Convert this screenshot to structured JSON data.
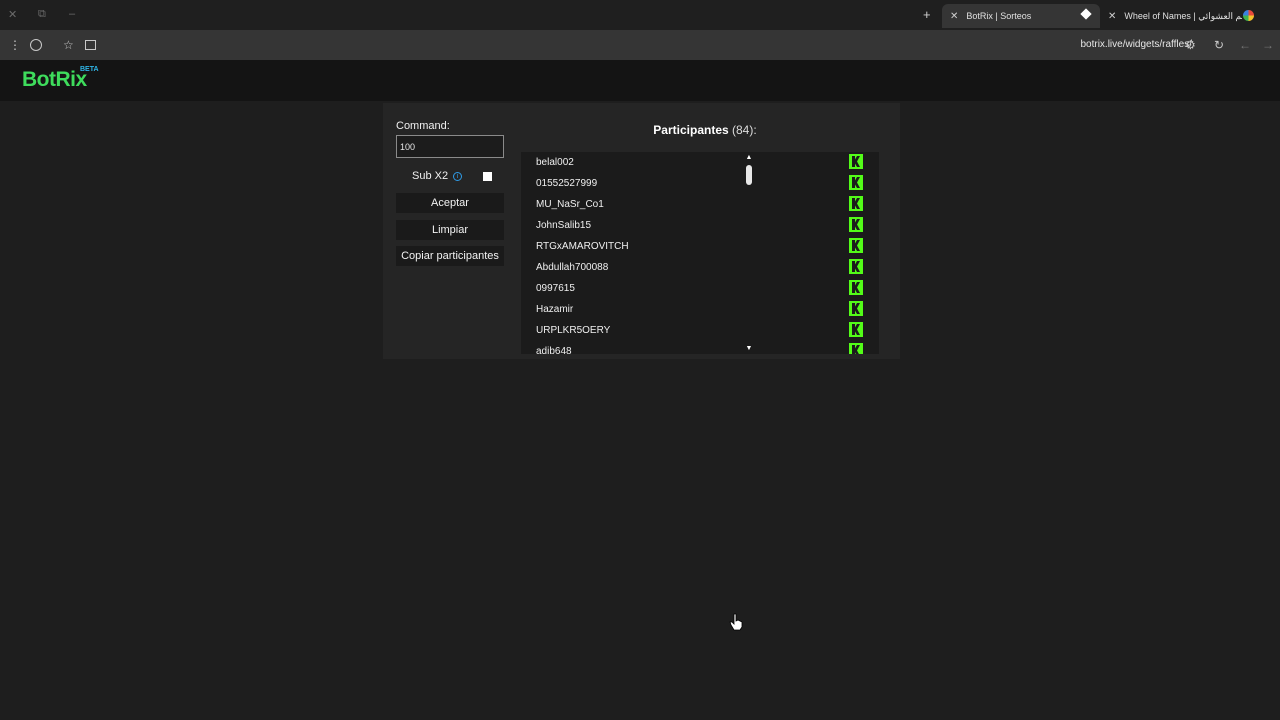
{
  "browser": {
    "window_controls": [
      "✕",
      "⧉",
      "–"
    ],
    "new_tab_label": "+",
    "tabs": [
      {
        "title": "BotRix | Sorteos",
        "active": true
      },
      {
        "title": "Wheel of Names | اسم العشوائي",
        "active": false
      }
    ],
    "url": "botrix.live/widgets/raffles/"
  },
  "site": {
    "logo": "BotRix",
    "logo_badge": "BETA",
    "logo_color": "#3edc5c",
    "badge_color": "#2fb6e8"
  },
  "controls": {
    "command_label": "Command:",
    "command_value": "100",
    "sub_label": "Sub X2",
    "sub_checked": false,
    "accept_label": "Aceptar",
    "clear_label": "Limpiar",
    "copy_label": "Copiar participantes"
  },
  "participants": {
    "title": "Participantes",
    "count": "(84):",
    "icon": "kick-icon",
    "icon_color": "#53fc18",
    "items": [
      {
        "name": "belal002"
      },
      {
        "name": "01552527999"
      },
      {
        "name": "MU_NaSr_Co1"
      },
      {
        "name": "JohnSalib15"
      },
      {
        "name": "RTGxAMAROVITCH"
      },
      {
        "name": "Abdullah700088"
      },
      {
        "name": "0997615"
      },
      {
        "name": "Hazamir"
      },
      {
        "name": "URPLKR5OERY"
      },
      {
        "name": "adib648"
      }
    ]
  }
}
